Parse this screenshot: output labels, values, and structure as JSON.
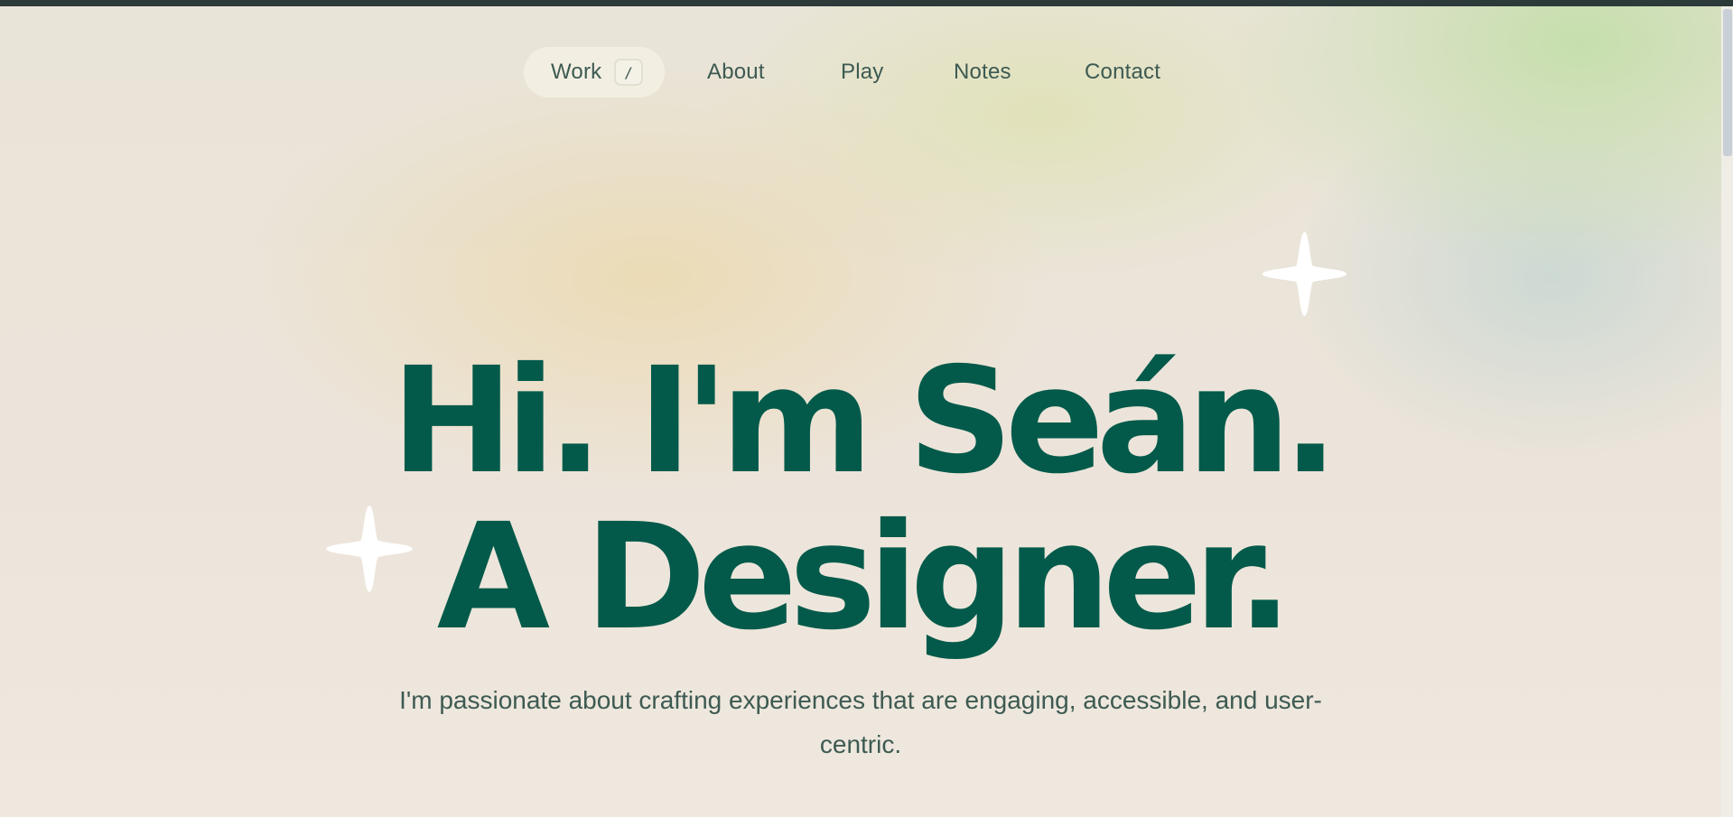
{
  "nav": {
    "items": [
      {
        "label": "Work",
        "shortcut": "/"
      },
      {
        "label": "About"
      },
      {
        "label": "Play"
      },
      {
        "label": "Notes"
      },
      {
        "label": "Contact"
      }
    ],
    "active": "Work"
  },
  "hero": {
    "line1": "Hi. I'm Seán.",
    "line2": "A Designer.",
    "subtitle": "I'm passionate about crafting experiences that are engaging, accessible, and user-centric."
  },
  "colors": {
    "headline": "#035a4a",
    "nav_text": "#3d5a52",
    "active_pill": "#f2efe2",
    "sparkle": "#ffffff"
  },
  "icons": [
    "sparkle-icon",
    "sparkle-icon"
  ]
}
